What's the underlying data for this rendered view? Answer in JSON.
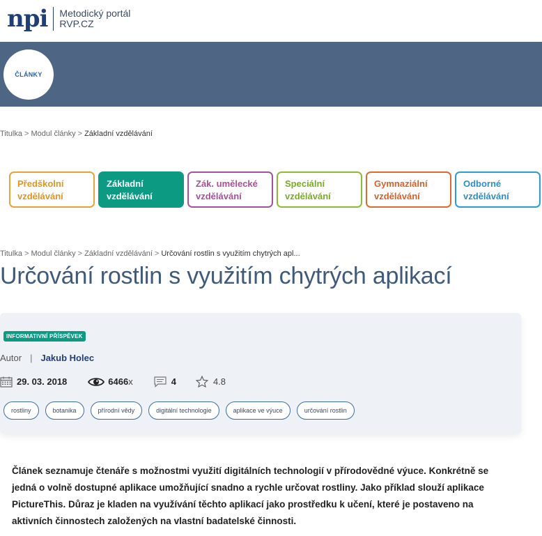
{
  "header": {
    "logo_mark": "npi",
    "logo_line1": "Metodický portál",
    "logo_line2": "RVP.CZ",
    "section_badge": "ČLÁNKY"
  },
  "breadcrumb_top": [
    "Titulka",
    "Modul články",
    "Základní vzdělávání"
  ],
  "categories": [
    {
      "line1": "Předškolní",
      "line2": "vzdělávání"
    },
    {
      "line1": "Základní",
      "line2": "vzdělávání"
    },
    {
      "line1": "Zák. umělecké",
      "line2": "vzdělávání"
    },
    {
      "line1": "Speciální",
      "line2": "vzdělávání"
    },
    {
      "line1": "Gymnaziální",
      "line2": "vzdělávání"
    },
    {
      "line1": "Odborné",
      "line2": "vzdělávání"
    }
  ],
  "breadcrumb_article": [
    "Titulka",
    "Modul články",
    "Základní vzdělávání",
    "Určování rostlin s využitím chytrých apl..."
  ],
  "article": {
    "title": "Určování rostlin s využitím chytrých aplikací",
    "type_badge": "INFORMATIVNÍ PŘÍSPĚVEK",
    "author_label": "Autor",
    "author_separator": "|",
    "author_name": "Jakub Holec",
    "date": "29. 03. 2018",
    "views": "6466",
    "views_suffix": "x",
    "comments": "4",
    "rating": "4.8",
    "tags": [
      "rostliny",
      "botanika",
      "přírodní vědy",
      "digitální technologie",
      "aplikace ve výuce",
      "určování rostlin"
    ],
    "abstract": "Článek seznamuje čtenáře s možnostmi využití digitálních technologií v přírodovědné výuce. Konkrétně se jedná o volně dostupné aplikace umožňující snadno a rychle určovat rostliny. Jako příklad slouží aplikace PictureThis. Důraz je kladen na využívání těchto aplikací jako prostředku k učení, které je postaveno na aktivních činnostech založených na vlastní badatelské činnosti."
  },
  "icons": {
    "calendar": "calendar-icon",
    "views": "eye-icon",
    "comments": "comment-icon",
    "rating": "star-icon"
  },
  "colors": {
    "banner": "#4e6683",
    "brand_blue": "#1f3f76",
    "teal": "#0d9a82",
    "title": "#3f5a7a"
  }
}
